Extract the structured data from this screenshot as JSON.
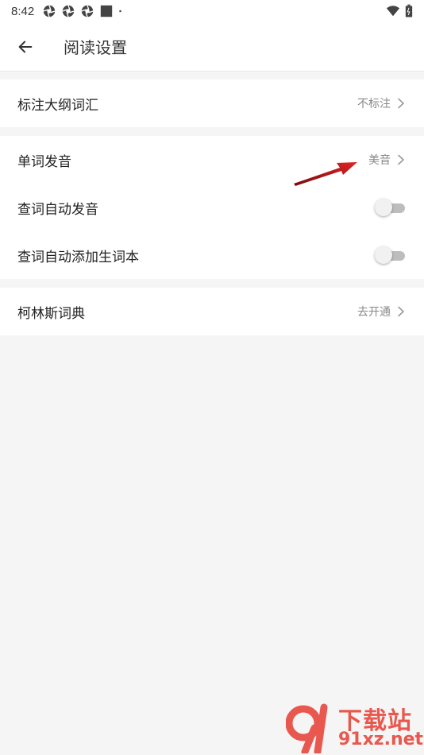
{
  "status_bar": {
    "time": "8:42"
  },
  "app_bar": {
    "title": "阅读设置"
  },
  "groups": [
    {
      "rows": [
        {
          "label": "标注大纲词汇",
          "value": "不标注",
          "type": "link"
        }
      ]
    },
    {
      "rows": [
        {
          "label": "单词发音",
          "value": "美音",
          "type": "link"
        },
        {
          "label": "查词自动发音",
          "type": "toggle",
          "on": false
        },
        {
          "label": "查词自动添加生词本",
          "type": "toggle",
          "on": false
        }
      ]
    },
    {
      "rows": [
        {
          "label": "柯林斯词典",
          "value": "去开通",
          "type": "link"
        }
      ]
    }
  ],
  "watermark": {
    "line1": "下载站",
    "line2": "91xz.net"
  },
  "colors": {
    "annotation_arrow": "#d81e1e",
    "watermark": "#e8584f"
  }
}
